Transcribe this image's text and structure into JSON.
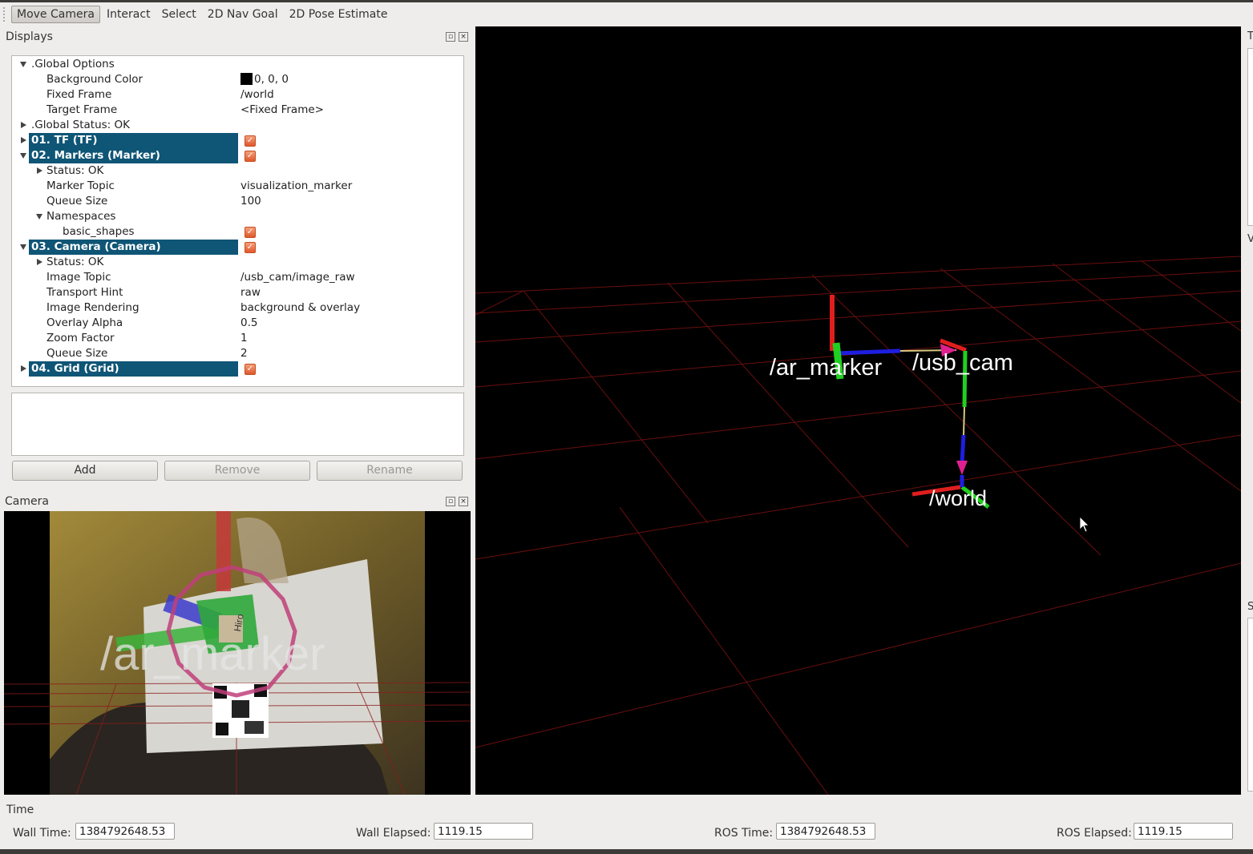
{
  "toolbar": {
    "items": [
      "Move Camera",
      "Interact",
      "Select",
      "2D Nav Goal",
      "2D Pose Estimate"
    ]
  },
  "displays_panel": {
    "title": "Displays",
    "rows": {
      "global_options": ".Global Options",
      "background_color": {
        "label": "Background Color",
        "value": "0, 0, 0",
        "swatch": "#000000"
      },
      "fixed_frame": {
        "label": "Fixed Frame",
        "value": "/world"
      },
      "target_frame": {
        "label": "Target Frame",
        "value": "<Fixed Frame>"
      },
      "global_status": ".Global Status: OK",
      "tf": "01. TF (TF)",
      "markers": "02. Markers (Marker)",
      "markers_status": "Status: OK",
      "marker_topic": {
        "label": "Marker Topic",
        "value": "visualization_marker"
      },
      "markers_queue": {
        "label": "Queue Size",
        "value": "100"
      },
      "namespaces": "Namespaces",
      "basic_shapes": "basic_shapes",
      "camera": "03. Camera (Camera)",
      "camera_status": "Status: OK",
      "image_topic": {
        "label": "Image Topic",
        "value": "/usb_cam/image_raw"
      },
      "transport_hint": {
        "label": "Transport Hint",
        "value": "raw"
      },
      "image_rendering": {
        "label": "Image Rendering",
        "value": "background & overlay"
      },
      "overlay_alpha": {
        "label": "Overlay Alpha",
        "value": "0.5"
      },
      "zoom_factor": {
        "label": "Zoom Factor",
        "value": "1"
      },
      "camera_queue": {
        "label": "Queue Size",
        "value": "2"
      },
      "grid": "04. Grid (Grid)"
    },
    "buttons": {
      "add": "Add",
      "remove": "Remove",
      "rename": "Rename"
    }
  },
  "camera_panel": {
    "title": "Camera",
    "overlay_label": "/ar_marker",
    "marker_text": "Hiro"
  },
  "scene": {
    "frames": [
      "/ar_marker",
      "/usb_cam",
      "/world"
    ]
  },
  "right_strip": {
    "letters": [
      "T",
      "V",
      "S"
    ]
  },
  "time_panel": {
    "title": "Time",
    "wall_time": {
      "label": "Wall Time:",
      "value": "1384792648.53"
    },
    "wall_elapsed": {
      "label": "Wall Elapsed:",
      "value": "1119.15"
    },
    "ros_time": {
      "label": "ROS Time:",
      "value": "1384792648.53"
    },
    "ros_elapsed": {
      "label": "ROS Elapsed:",
      "value": "1119.15"
    }
  },
  "colors": {
    "selection": "#0f5576",
    "checkbox": "#e0582d",
    "grid_line": "#7a0c0c"
  }
}
